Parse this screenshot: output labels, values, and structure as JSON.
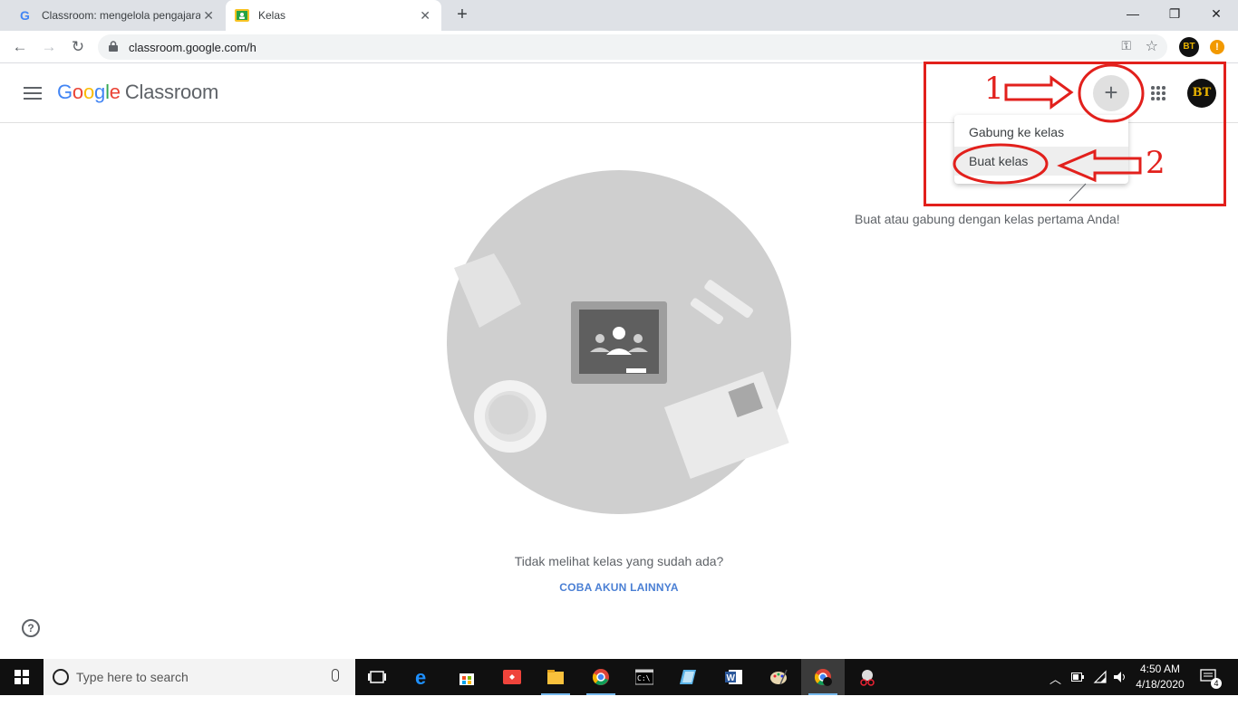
{
  "browser": {
    "tabs": [
      {
        "title": "Classroom: mengelola pengajaran",
        "active": false
      },
      {
        "title": "Kelas",
        "active": true
      }
    ],
    "url": "classroom.google.com/h"
  },
  "header": {
    "logo_google": [
      "G",
      "o",
      "o",
      "g",
      "l",
      "e"
    ],
    "logo_product": "Classroom"
  },
  "menu": {
    "items": [
      "Gabung ke kelas",
      "Buat kelas"
    ]
  },
  "annotations": {
    "step1": "1",
    "step2": "2"
  },
  "avatar_initials": "BT",
  "hint": "Buat atau gabung dengan kelas pertama Anda!",
  "empty_state": {
    "notice": "Tidak melihat kelas yang sudah ada?",
    "action": "COBA AKUN LAINNYA"
  },
  "taskbar": {
    "search_placeholder": "Type here to search",
    "time": "4:50 AM",
    "date": "4/18/2020",
    "notification_count": "4"
  },
  "colors": {
    "annotation_red": "#e2201c",
    "google_blue": "#4285f4",
    "google_red": "#ea4335",
    "google_yellow": "#fbbc05",
    "google_green": "#34a853",
    "link_blue": "#4a7fd4"
  }
}
